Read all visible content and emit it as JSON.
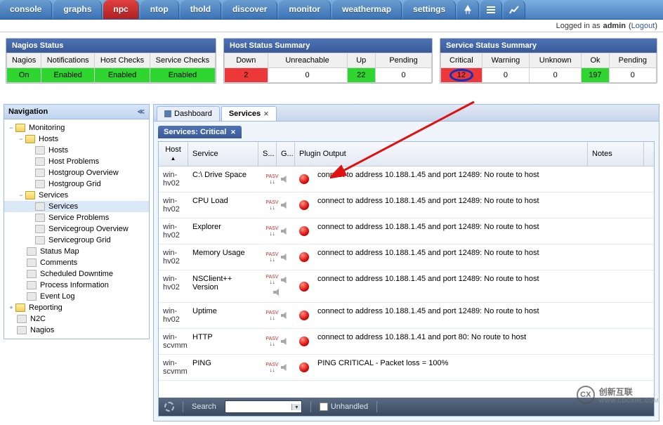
{
  "top_tabs": {
    "console": "console",
    "graphs": "graphs",
    "npc": "npc",
    "ntop": "ntop",
    "thold": "thold",
    "discover": "discover",
    "monitor": "monitor",
    "weathermap": "weathermap",
    "settings": "settings"
  },
  "login": {
    "prefix": "Logged in as",
    "user": "admin",
    "logout": "Logout"
  },
  "nagios_status": {
    "title": "Nagios Status",
    "headers": {
      "nagios": "Nagios",
      "notifications": "Notifications",
      "host_checks": "Host Checks",
      "service_checks": "Service Checks"
    },
    "values": {
      "nagios": "On",
      "notifications": "Enabled",
      "host_checks": "Enabled",
      "service_checks": "Enabled"
    }
  },
  "host_status": {
    "title": "Host Status Summary",
    "headers": {
      "down": "Down",
      "unreachable": "Unreachable",
      "up": "Up",
      "pending": "Pending"
    },
    "values": {
      "down": "2",
      "unreachable": "0",
      "up": "22",
      "pending": "0"
    }
  },
  "service_status": {
    "title": "Service Status Summary",
    "headers": {
      "critical": "Critical",
      "warning": "Warning",
      "unknown": "Unknown",
      "ok": "Ok",
      "pending": "Pending"
    },
    "values": {
      "critical": "12",
      "warning": "0",
      "unknown": "0",
      "ok": "197",
      "pending": "0"
    }
  },
  "nav": {
    "title": "Navigation",
    "tree": {
      "monitoring": "Monitoring",
      "hosts": "Hosts",
      "hosts_leaf": "Hosts",
      "host_problems": "Host Problems",
      "hostgroup_overview": "Hostgroup Overview",
      "hostgroup_grid": "Hostgroup Grid",
      "services": "Services",
      "services_leaf": "Services",
      "service_problems": "Service Problems",
      "servicegroup_overview": "Servicegroup Overview",
      "servicegroup_grid": "Servicegroup Grid",
      "status_map": "Status Map",
      "comments": "Comments",
      "scheduled_downtime": "Scheduled Downtime",
      "process_information": "Process Information",
      "event_log": "Event Log",
      "reporting": "Reporting",
      "n2c": "N2C",
      "nagios": "Nagios"
    }
  },
  "main": {
    "tabs": {
      "dashboard": "Dashboard",
      "services": "Services"
    },
    "subtab": "Services: Critical",
    "headers": {
      "host": "Host",
      "service": "Service",
      "s": "S...",
      "g": "G...",
      "plugin": "Plugin Output",
      "notes": "Notes"
    },
    "pasv_label": "PASV",
    "rows": [
      {
        "host": "win-hv02",
        "service": "C:\\ Drive Space",
        "output": "connect to address 10.188.1.45 and port 12489: No route to host"
      },
      {
        "host": "win-hv02",
        "service": "CPU Load",
        "output": "connect to address 10.188.1.45 and port 12489: No route to host"
      },
      {
        "host": "win-hv02",
        "service": "Explorer",
        "output": "connect to address 10.188.1.45 and port 12489: No route to host"
      },
      {
        "host": "win-hv02",
        "service": "Memory Usage",
        "output": "connect to address 10.188.1.45 and port 12489: No route to host"
      },
      {
        "host": "win-hv02",
        "service": "NSClient++ Version",
        "output": "connect to address 10.188.1.45 and port 12489: No route to host"
      },
      {
        "host": "win-hv02",
        "service": "Uptime",
        "output": "connect to address 10.188.1.45 and port 12489: No route to host"
      },
      {
        "host": "win-scvmm",
        "service": "HTTP",
        "output": "connect to address 10.188.1.41 and port 80: No route to host"
      },
      {
        "host": "win-scvmm",
        "service": "PING",
        "output": "PING CRITICAL - Packet loss = 100%"
      }
    ],
    "footer": {
      "search": "Search",
      "unhandled": "Unhandled"
    }
  },
  "watermark": {
    "cn": "创新互联",
    "url": "WWW.CDCXHL.COM",
    "logo": "CX"
  }
}
